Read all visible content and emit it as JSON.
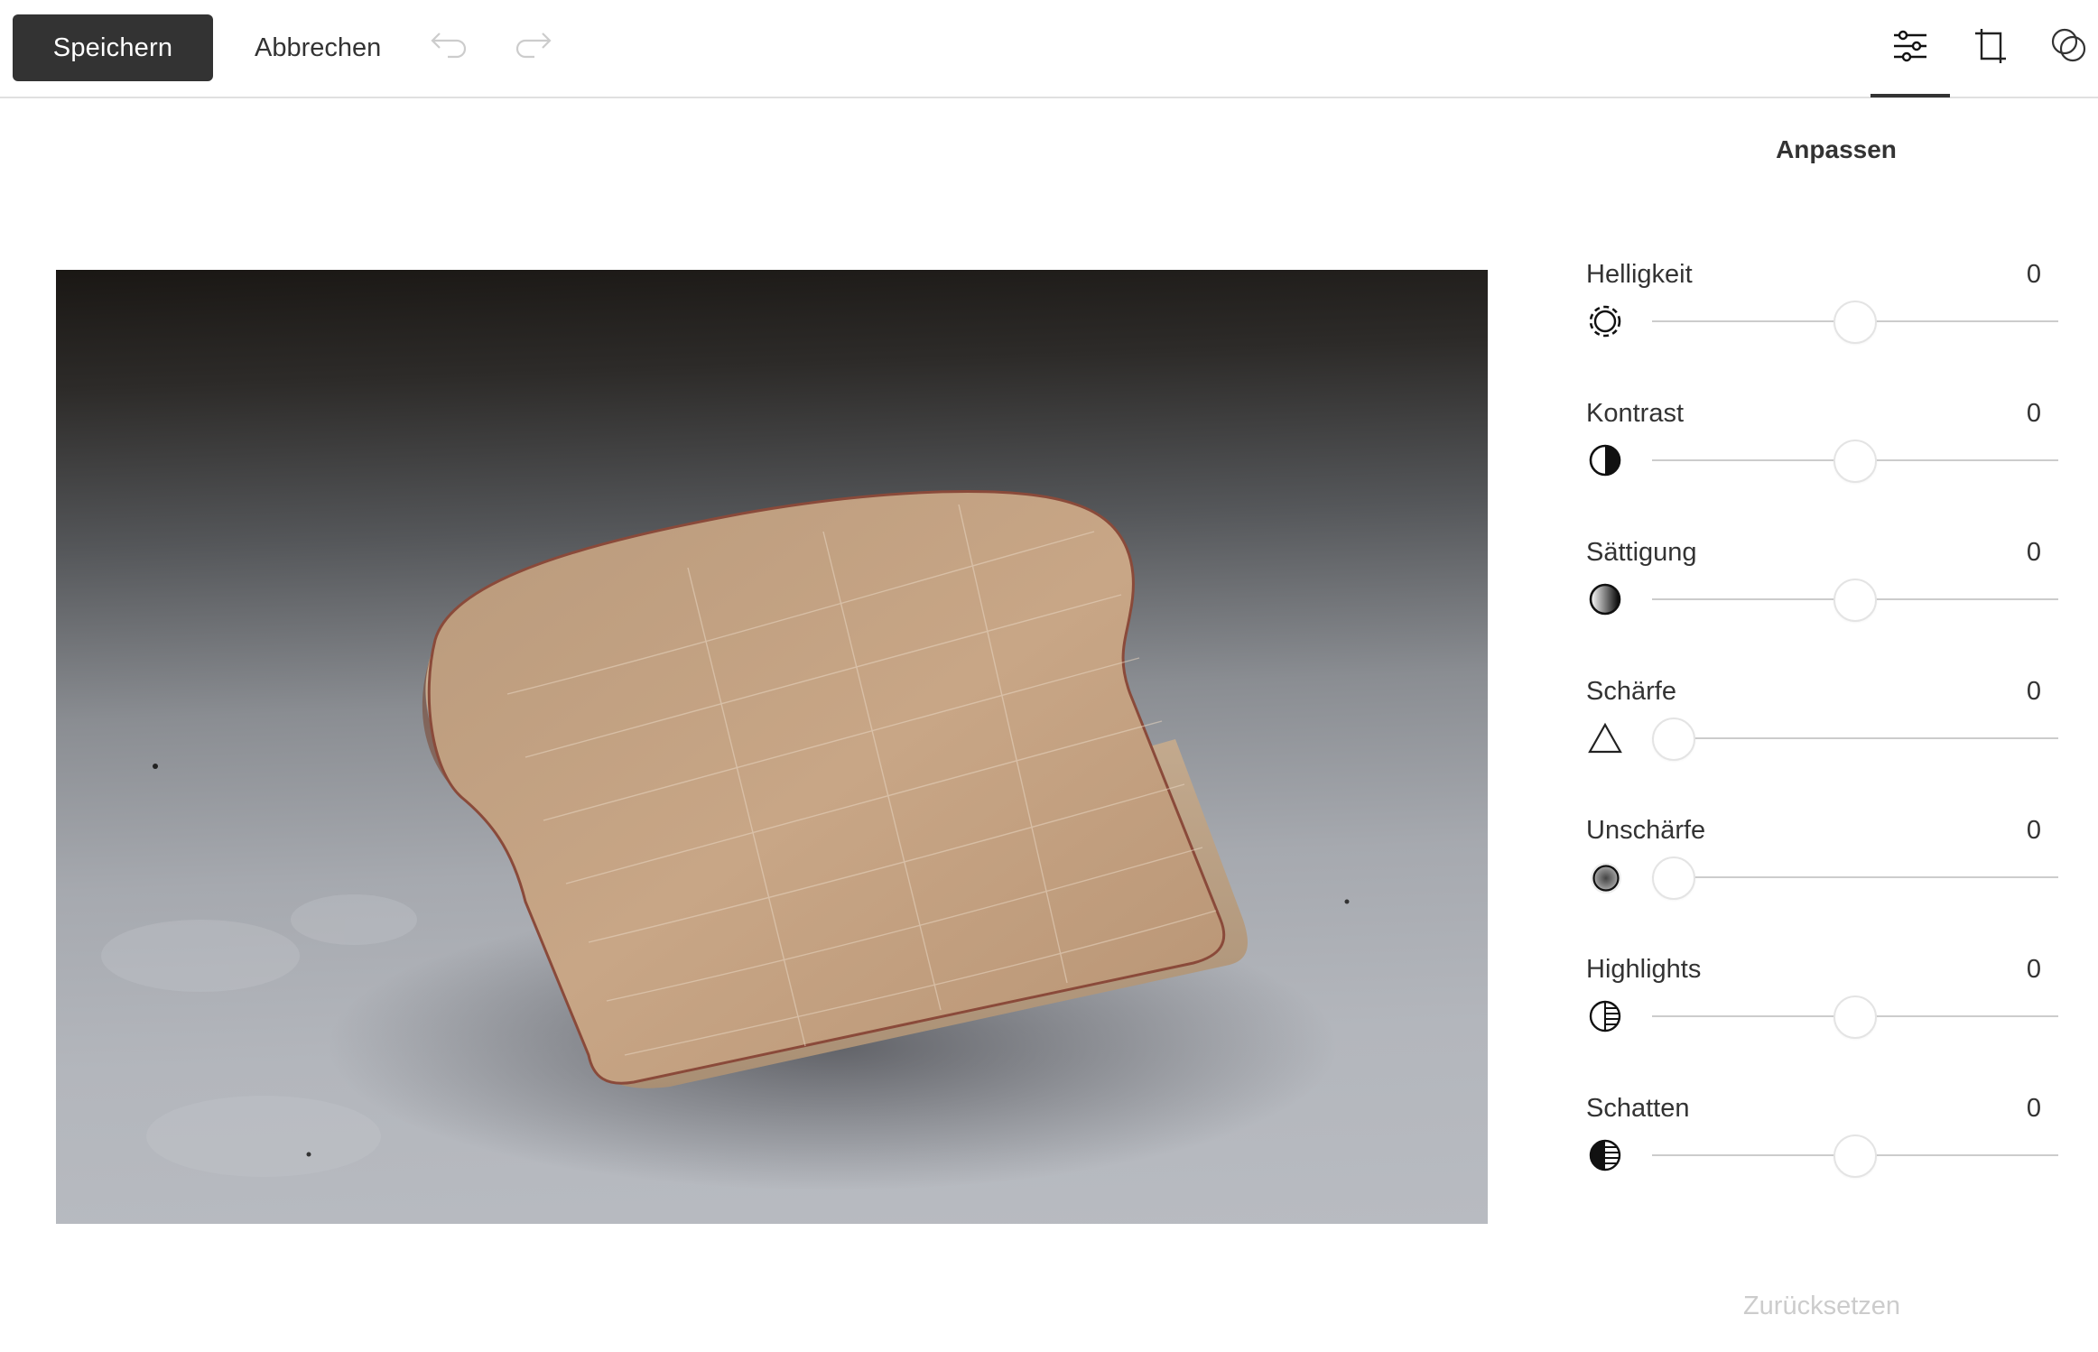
{
  "toolbar": {
    "save_label": "Speichern",
    "cancel_label": "Abbrechen",
    "undo_icon": "undo-icon",
    "redo_icon": "redo-icon",
    "undo_enabled": false,
    "redo_enabled": false
  },
  "tools": [
    {
      "id": "adjust",
      "icon": "sliders-icon",
      "active": true
    },
    {
      "id": "crop",
      "icon": "crop-icon",
      "active": false
    },
    {
      "id": "filter",
      "icon": "filter-circles-icon",
      "active": false
    }
  ],
  "canvas": {
    "image_description": "Wooden toast-shaped block on a grey surface"
  },
  "panel": {
    "title": "Anpassen",
    "adjustments": [
      {
        "id": "brightness",
        "label": "Helligkeit",
        "value": "0",
        "icon": "brightness-icon",
        "min": -100,
        "max": 100,
        "current": 0
      },
      {
        "id": "contrast",
        "label": "Kontrast",
        "value": "0",
        "icon": "contrast-icon",
        "min": -100,
        "max": 100,
        "current": 0
      },
      {
        "id": "saturation",
        "label": "Sättigung",
        "value": "0",
        "icon": "saturation-icon",
        "min": -100,
        "max": 100,
        "current": 0
      },
      {
        "id": "sharpness",
        "label": "Schärfe",
        "value": "0",
        "icon": "sharpness-icon",
        "min": 0,
        "max": 100,
        "current": 0
      },
      {
        "id": "blur",
        "label": "Unschärfe",
        "value": "0",
        "icon": "blur-icon",
        "min": 0,
        "max": 100,
        "current": 0
      },
      {
        "id": "highlights",
        "label": "Highlights",
        "value": "0",
        "icon": "highlights-icon",
        "min": -100,
        "max": 100,
        "current": 0
      },
      {
        "id": "shadows",
        "label": "Schatten",
        "value": "0",
        "icon": "shadows-icon",
        "min": -100,
        "max": 100,
        "current": 0
      }
    ],
    "reset_label": "Zurücksetzen",
    "reset_enabled": false
  },
  "colors": {
    "primary_button": "#333333",
    "text": "#333333",
    "disabled": "#cccccc",
    "divider": "#e0e0e0",
    "track": "#cccccc"
  }
}
